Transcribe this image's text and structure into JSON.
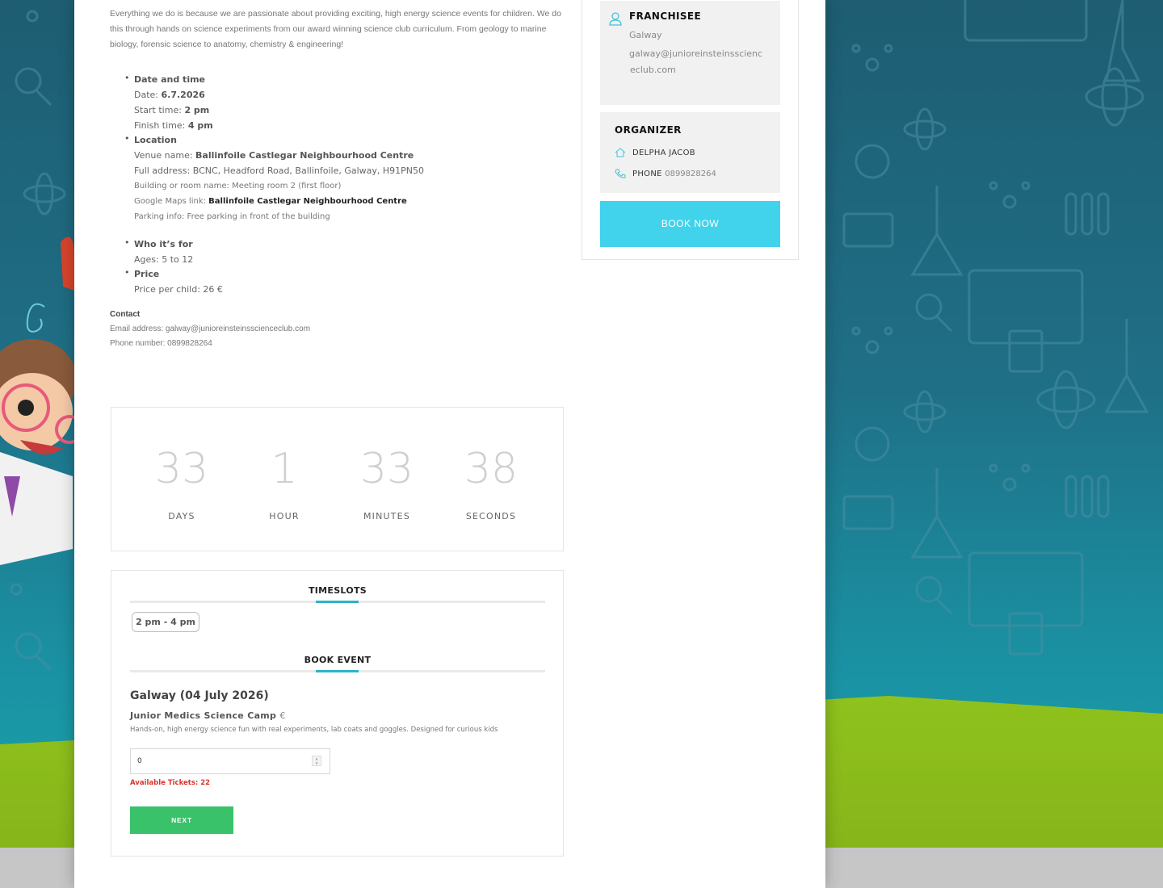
{
  "colors": {
    "accent": "#41d2ec",
    "next_button": "#3ac26a",
    "available_text": "#d8342c",
    "background_teal": "#1f6f86",
    "grass": "#8fc21d"
  },
  "intro": {
    "text": "Everything we do is because we are passionate about providing exciting, high energy science events for children. We do this through hands on science experiments from our award winning science club curriculum. From geology to marine biology, forensic science to anatomy, chemistry & engineering!"
  },
  "details": {
    "datetime": {
      "title": "Date and time",
      "date_label": "Date: ",
      "date_value": "6.7.2026",
      "start_label": "Start time: ",
      "start_value": "2 pm",
      "finish_label": "Finish time: ",
      "finish_value": "4 pm"
    },
    "location": {
      "title": "Location",
      "venue_label": "Venue name: ",
      "venue_value": "Ballinfoile Castlegar Neighbourhood Centre",
      "address": "Full address: BCNC, Headford Road, Ballinfoile, Galway, H91PN50",
      "room": "Building or room name: Meeting room 2 (first floor)",
      "maps_label": "Google Maps link: ",
      "maps_link": "Ballinfoile Castlegar Neighbourhood Centre",
      "parking": "Parking info: Free parking in front of the building"
    },
    "audience": {
      "title": "Who it’s for",
      "ages": "Ages: 5 to 12"
    },
    "price": {
      "title": "Price",
      "value": "Price per child: 26 €"
    }
  },
  "contact": {
    "title": "Contact",
    "email": "Email address: galway@junioreinsteinsscienceclub.com",
    "phone": "Phone number: 0899828264"
  },
  "countdown": {
    "days": "33",
    "days_label": "DAYS",
    "hours": "1",
    "hours_label": "HOUR",
    "minutes": "33",
    "minutes_label": "MINUTES",
    "seconds": "38",
    "seconds_label": "SECONDS"
  },
  "booking": {
    "timeslots_title": "TIMESLOTS",
    "slot": "2 pm - 4 pm",
    "book_title": "BOOK EVENT",
    "event_title": "Galway (04 July 2026)",
    "event_name": "Junior Medics Science Camp",
    "currency": "€",
    "event_desc": "Hands-on, high energy science fun with real experiments, lab coats and goggles. Designed for curious kids",
    "quantity": "0",
    "available": "Available Tickets: 22",
    "next_label": "NEXT"
  },
  "sidebar": {
    "franchisee_title": "FRANCHISEE",
    "franchisee_city": "Galway",
    "franchisee_email_1": "galway@junioreinsteinsscienc",
    "franchisee_email_2": "eclub.com",
    "organizer_title": "ORGANIZER",
    "organizer_name": "DELPHA JACOB",
    "phone_label": "PHONE",
    "phone_value": "0899828264",
    "book_now_label": "BOOK NOW"
  },
  "icons": {
    "franchisee": "user-icon",
    "organizer_name": "home-icon",
    "organizer_phone": "phone-icon"
  }
}
